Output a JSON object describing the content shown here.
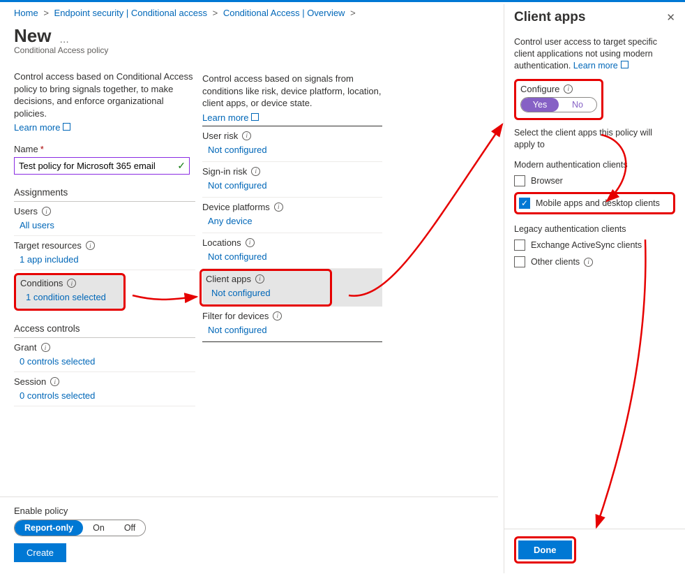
{
  "breadcrumb": [
    {
      "label": "Home"
    },
    {
      "label": "Endpoint security | Conditional access"
    },
    {
      "label": "Conditional Access | Overview"
    }
  ],
  "page": {
    "title": "New",
    "subtitle": "Conditional Access policy"
  },
  "col1": {
    "desc": "Control access based on Conditional Access policy to bring signals together, to make decisions, and enforce organizational policies.",
    "learn_more": "Learn more",
    "name_label": "Name",
    "name_value": "Test policy for Microsoft 365 email",
    "assignments_hdr": "Assignments",
    "users_label": "Users",
    "users_value": "All users",
    "target_label": "Target resources",
    "target_value": "1 app included",
    "conditions_label": "Conditions",
    "conditions_value": "1 condition selected",
    "access_hdr": "Access controls",
    "grant_label": "Grant",
    "grant_value": "0 controls selected",
    "session_label": "Session",
    "session_value": "0 controls selected"
  },
  "col2": {
    "desc": "Control access based on signals from conditions like risk, device platform, location, client apps, or device state.",
    "learn_more": "Learn more",
    "rows": {
      "user_risk": {
        "label": "User risk",
        "value": "Not configured"
      },
      "signin_risk": {
        "label": "Sign-in risk",
        "value": "Not configured"
      },
      "device_platforms": {
        "label": "Device platforms",
        "value": "Any device"
      },
      "locations": {
        "label": "Locations",
        "value": "Not configured"
      },
      "client_apps": {
        "label": "Client apps",
        "value": "Not configured"
      },
      "filter_devices": {
        "label": "Filter for devices",
        "value": "Not configured"
      }
    }
  },
  "footer": {
    "enable_label": "Enable policy",
    "opts": [
      "Report-only",
      "On",
      "Off"
    ],
    "create": "Create"
  },
  "pane": {
    "title": "Client apps",
    "desc": "Control user access to target specific client applications not using modern authentication.",
    "learn_more": "Learn more",
    "configure_label": "Configure",
    "yes": "Yes",
    "no": "No",
    "select_desc": "Select the client apps this policy will apply to",
    "modern_hdr": "Modern authentication clients",
    "chk_browser": "Browser",
    "chk_mobile": "Mobile apps and desktop clients",
    "legacy_hdr": "Legacy authentication clients",
    "chk_eas": "Exchange ActiveSync clients",
    "chk_other": "Other clients",
    "done": "Done"
  }
}
